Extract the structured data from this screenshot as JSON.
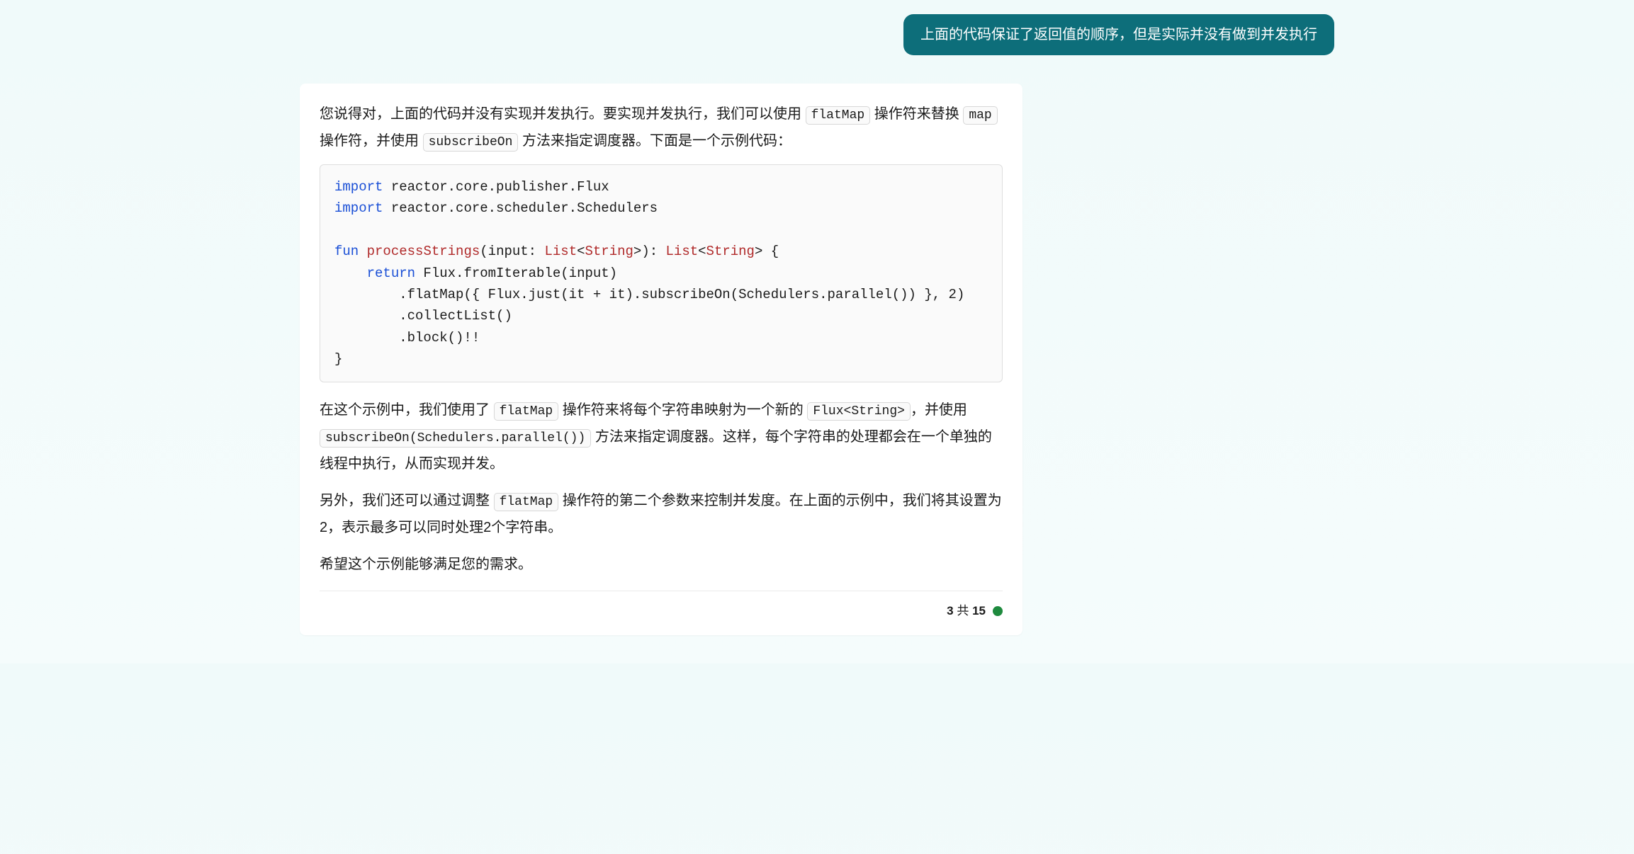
{
  "user": {
    "message": "上面的代码保证了返回值的顺序，但是实际并没有做到并发执行"
  },
  "assistant": {
    "p1_prefix": "您说得对，上面的代码并没有实现并发执行。要实现并发执行，我们可以使用 ",
    "p1_code1": "flatMap",
    "p1_mid1": " 操作符来替换 ",
    "p1_code2": "map",
    "p1_mid2": " 操作符，并使用 ",
    "p1_code3": "subscribeOn",
    "p1_suffix": " 方法来指定调度器。下面是一个示例代码：",
    "code": {
      "l1a": "import",
      "l1b": " reactor.core.publisher.Flux",
      "l2a": "import",
      "l2b": " reactor.core.scheduler.Schedulers",
      "l4a": "fun",
      "l4b": " ",
      "l4c": "processStrings",
      "l4d": "(input: ",
      "l4e": "List",
      "l4f": "<",
      "l4g": "String",
      "l4h": ">): ",
      "l4i": "List",
      "l4j": "<",
      "l4k": "String",
      "l4l": "> {",
      "l5a": "    ",
      "l5b": "return",
      "l5c": " Flux.fromIterable(input)",
      "l6": "        .flatMap({ Flux.just(it + it).subscribeOn(Schedulers.parallel()) }, 2)",
      "l7": "        .collectList()",
      "l8": "        .block()!!",
      "l9": "}"
    },
    "p2_prefix": "在这个示例中，我们使用了 ",
    "p2_code1": "flatMap",
    "p2_mid1": " 操作符来将每个字符串映射为一个新的 ",
    "p2_code2": "Flux<String>",
    "p2_mid2": "，并使用 ",
    "p2_code3": "subscribeOn(Schedulers.parallel())",
    "p2_suffix": " 方法来指定调度器。这样，每个字符串的处理都会在一个单独的线程中执行，从而实现并发。",
    "p3_prefix": "另外，我们还可以通过调整 ",
    "p3_code1": "flatMap",
    "p3_suffix": " 操作符的第二个参数来控制并发度。在上面的示例中，我们将其设置为2，表示最多可以同时处理2个字符串。",
    "p4": "希望这个示例能够满足您的需求。"
  },
  "footer": {
    "current": "3",
    "sep": " 共 ",
    "total": "15"
  }
}
